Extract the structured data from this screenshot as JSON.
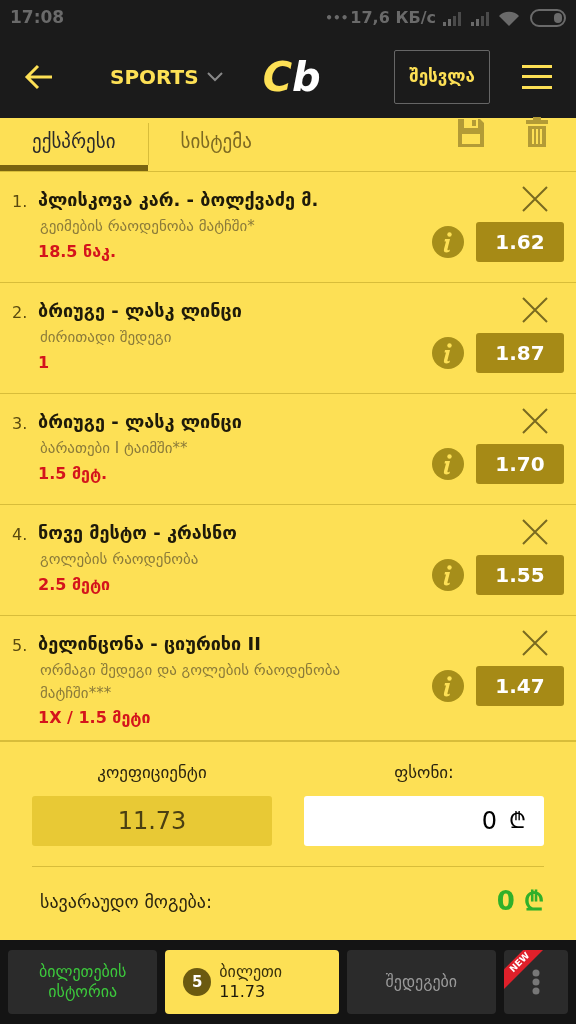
{
  "status_bar": {
    "time": "17:08",
    "dots": "•••",
    "speed": "17,6 КБ/с"
  },
  "header": {
    "section": "SPORTS",
    "logo": [
      "C",
      "b"
    ],
    "login": "შესვლა"
  },
  "tabs": [
    {
      "label": "ექსპრესი",
      "selected": true
    },
    {
      "label": "სისტემა",
      "selected": false
    }
  ],
  "bets": [
    {
      "number": "1.",
      "match": "პლისკოვა კარ. - ბოლქვაძე მ.",
      "market": "გეიმების რაოდენობა მატჩში*",
      "pick": "18.5 ნაკ.",
      "odds": "1.62"
    },
    {
      "number": "2.",
      "match": "ბრიუგე - ლასკ ლინცი",
      "market": "ძირითადი შედეგი",
      "pick": "1",
      "odds": "1.87"
    },
    {
      "number": "3.",
      "match": "ბრიუგე - ლასკ ლინცი",
      "market": "ბარათები I ტაიმში**",
      "pick": "1.5 მეტ.",
      "odds": "1.70"
    },
    {
      "number": "4.",
      "match": "ნოვე მესტო - კრასნო",
      "market": "გოლების რაოდენობა",
      "pick": "2.5 მეტი",
      "odds": "1.55"
    },
    {
      "number": "5.",
      "match": "ბელინცონა - ციურიხი II",
      "market": "ორმაგი შედეგი და გოლების რაოდენობა მატჩში***",
      "pick": "1X / 1.5 მეტი",
      "odds": "1.47"
    }
  ],
  "summary": {
    "coef_label": "კოეფიციენტი",
    "coef": "11.73",
    "stake_label": "ფსონი:",
    "stake": "0",
    "currency": "₾",
    "win_label": "სავარაუდო მოგება:",
    "win": "0",
    "win_currency": "₾"
  },
  "nav": [
    {
      "kind": "text",
      "label": "ბილეთების ისტორია",
      "color": "#3cc83c",
      "selected": false
    },
    {
      "kind": "ticket",
      "count": "5",
      "label": "ბილეთი",
      "value": "11.73",
      "selected": true
    },
    {
      "kind": "text",
      "label": "შედეგები",
      "color": "#9a9a9a",
      "selected": false
    },
    {
      "kind": "more",
      "badge": "NEW",
      "selected": false
    }
  ]
}
